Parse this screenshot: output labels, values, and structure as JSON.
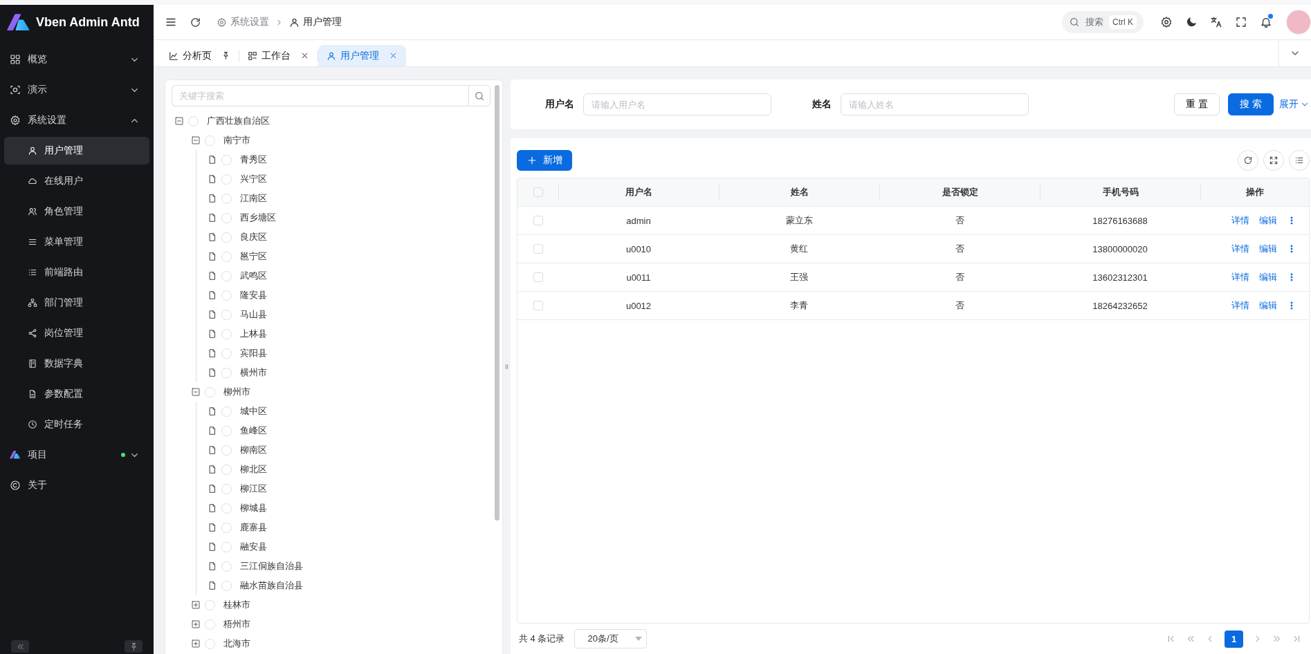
{
  "app": {
    "title": "Vben Admin Antd"
  },
  "sidebar": {
    "items": [
      {
        "label": "概览",
        "expanded": false,
        "selected": false
      },
      {
        "label": "演示",
        "expanded": false,
        "selected": false
      },
      {
        "label": "系统设置",
        "expanded": true,
        "selected": false,
        "children": [
          {
            "label": "用户管理",
            "selected": true
          },
          {
            "label": "在线用户",
            "selected": false
          },
          {
            "label": "角色管理",
            "selected": false
          },
          {
            "label": "菜单管理",
            "selected": false
          },
          {
            "label": "前端路由",
            "selected": false
          },
          {
            "label": "部门管理",
            "selected": false
          },
          {
            "label": "岗位管理",
            "selected": false
          },
          {
            "label": "数据字典",
            "selected": false
          },
          {
            "label": "参数配置",
            "selected": false
          },
          {
            "label": "定时任务",
            "selected": false
          }
        ]
      },
      {
        "label": "项目",
        "expanded": false,
        "selected": false,
        "dot": true
      },
      {
        "label": "关于",
        "selected": false
      }
    ]
  },
  "header": {
    "breadcrumb": [
      "系统设置",
      "用户管理"
    ],
    "search": {
      "placeholder": "搜索",
      "shortcut": "Ctrl K"
    },
    "notification_dot": true
  },
  "tabs": [
    {
      "label": "分析页",
      "selected": false,
      "pinned": true
    },
    {
      "label": "工作台",
      "selected": false,
      "pinned": false
    },
    {
      "label": "用户管理",
      "selected": true,
      "pinned": false
    }
  ],
  "tree": {
    "search": {
      "placeholder": "关键字搜索"
    },
    "nodes": [
      {
        "label": "广西壮族自治区",
        "checked": false,
        "expanded": true,
        "children": [
          {
            "label": "南宁市",
            "checked": false,
            "expanded": true,
            "children": [
              {
                "label": "青秀区",
                "checked": false
              },
              {
                "label": "兴宁区",
                "checked": false
              },
              {
                "label": "江南区",
                "checked": false
              },
              {
                "label": "西乡塘区",
                "checked": false
              },
              {
                "label": "良庆区",
                "checked": false
              },
              {
                "label": "邕宁区",
                "checked": false
              },
              {
                "label": "武鸣区",
                "checked": false
              },
              {
                "label": "隆安县",
                "checked": false
              },
              {
                "label": "马山县",
                "checked": false
              },
              {
                "label": "上林县",
                "checked": false
              },
              {
                "label": "宾阳县",
                "checked": false
              },
              {
                "label": "横州市",
                "checked": false
              }
            ]
          },
          {
            "label": "柳州市",
            "checked": false,
            "expanded": true,
            "children": [
              {
                "label": "城中区",
                "checked": false
              },
              {
                "label": "鱼峰区",
                "checked": false
              },
              {
                "label": "柳南区",
                "checked": false
              },
              {
                "label": "柳北区",
                "checked": false
              },
              {
                "label": "柳江区",
                "checked": false
              },
              {
                "label": "柳城县",
                "checked": false
              },
              {
                "label": "鹿寨县",
                "checked": false
              },
              {
                "label": "融安县",
                "checked": false
              },
              {
                "label": "三江侗族自治县",
                "checked": false
              },
              {
                "label": "融水苗族自治县",
                "checked": false
              }
            ]
          },
          {
            "label": "桂林市",
            "checked": false,
            "expanded": false
          },
          {
            "label": "梧州市",
            "checked": false,
            "expanded": false
          },
          {
            "label": "北海市",
            "checked": false,
            "expanded": false
          }
        ]
      }
    ]
  },
  "filters": {
    "fields": [
      {
        "label": "用户名",
        "placeholder": "请输入用户名"
      },
      {
        "label": "姓名",
        "placeholder": "请输入姓名"
      }
    ],
    "reset": "重 置",
    "submit": "搜 索",
    "expand": "展开"
  },
  "table": {
    "add_button": "新增",
    "header_checked": false,
    "columns": [
      "用户名",
      "姓名",
      "是否锁定",
      "手机号码",
      "操作"
    ],
    "rows": [
      {
        "checked": false,
        "cells": [
          "admin",
          "蒙立东",
          "否",
          "18276163688"
        ],
        "actions": [
          "详情",
          "编辑"
        ]
      },
      {
        "checked": false,
        "cells": [
          "u0010",
          "黄红",
          "否",
          "13800000020"
        ],
        "actions": [
          "详情",
          "编辑"
        ]
      },
      {
        "checked": false,
        "cells": [
          "u0011",
          "王强",
          "否",
          "13602312301"
        ],
        "actions": [
          "详情",
          "编辑"
        ]
      },
      {
        "checked": false,
        "cells": [
          "u0012",
          "李青",
          "否",
          "18264232652"
        ],
        "actions": [
          "详情",
          "编辑"
        ]
      }
    ]
  },
  "pagination": {
    "total": "共 4 条记录",
    "page_size": "20条/页",
    "pages": [
      {
        "label": "1",
        "selected": true
      }
    ]
  }
}
